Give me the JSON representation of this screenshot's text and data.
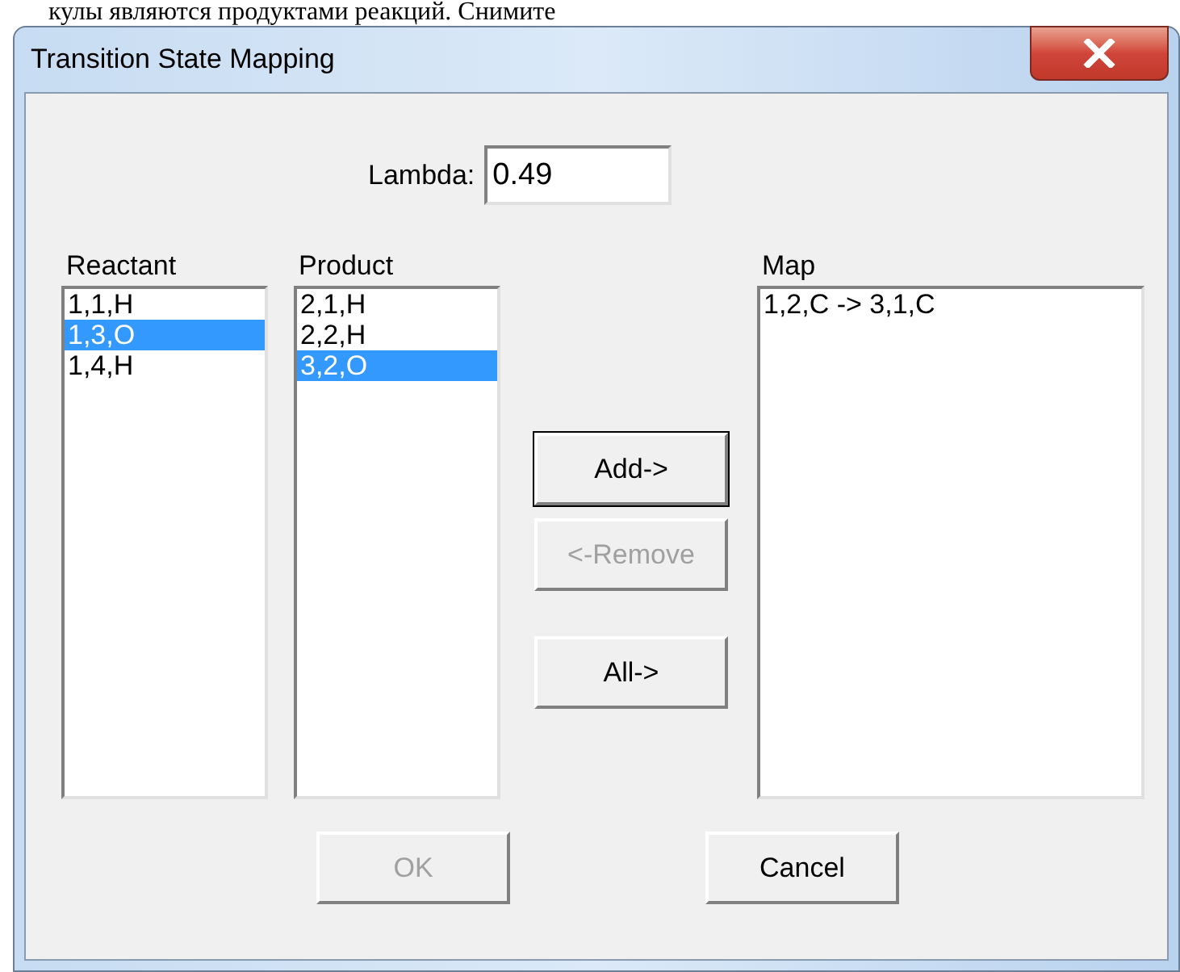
{
  "background_text": "кулы являются продуктами реакций. Снимите",
  "window": {
    "title": "Transition State Mapping"
  },
  "lambda": {
    "label": "Lambda:",
    "value": "0.49"
  },
  "lists": [
    {
      "label": "Reactant",
      "items": [
        {
          "text": "1,1,H",
          "selected": false
        },
        {
          "text": "1,3,O",
          "selected": true
        },
        {
          "text": "1,4,H",
          "selected": false
        }
      ]
    },
    {
      "label": "Product",
      "items": [
        {
          "text": "2,1,H",
          "selected": false
        },
        {
          "text": "2,2,H",
          "selected": false
        },
        {
          "text": "3,2,O",
          "selected": true
        }
      ]
    }
  ],
  "transfer_buttons": [
    {
      "label": "Add->",
      "disabled": false,
      "default": true
    },
    {
      "label": "<-Remove",
      "disabled": true,
      "default": false
    },
    {
      "label": "All->",
      "disabled": false,
      "default": false
    }
  ],
  "map": {
    "label": "Map",
    "items": [
      {
        "text": "1,2,C -> 3,1,C",
        "selected": false
      }
    ]
  },
  "buttons": [
    {
      "label": "OK",
      "disabled": true
    },
    {
      "label": "Cancel",
      "disabled": false
    }
  ]
}
